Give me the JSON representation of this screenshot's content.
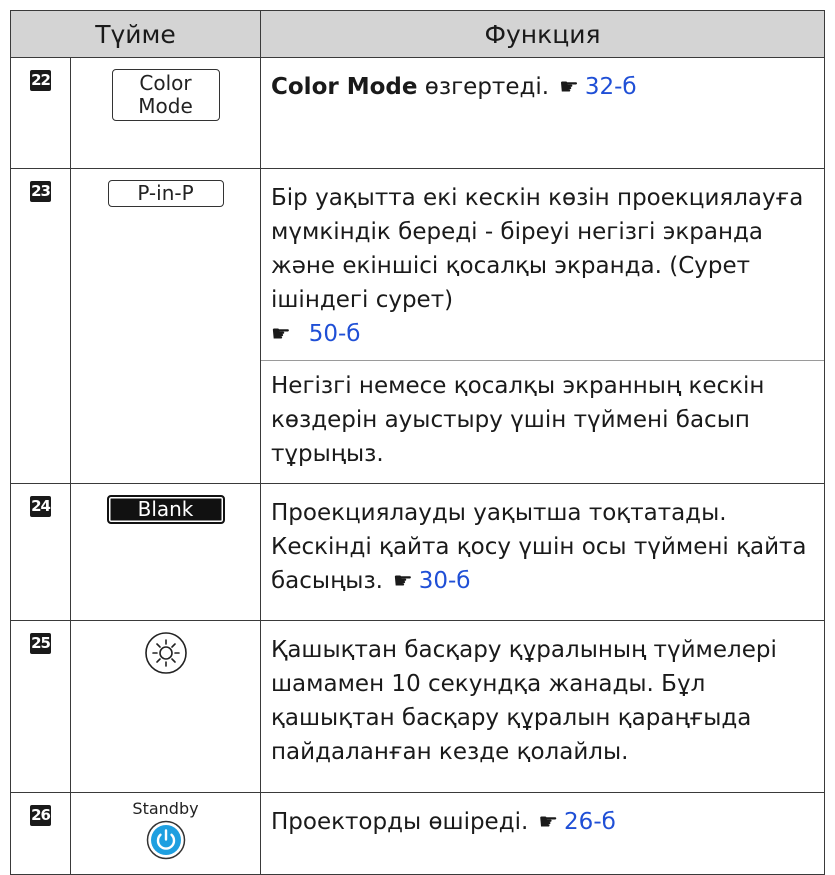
{
  "header": {
    "col_button": "Түйме",
    "col_function": "Функция"
  },
  "rows": [
    {
      "num": "22",
      "button_lines": [
        "Color",
        "Mode"
      ],
      "bold": "Color Mode",
      "text": " өзгертеді.",
      "ref": "32-б"
    },
    {
      "num": "23",
      "button_label": "P-in-P",
      "para1": "Бір уақытта екі кескін көзін проекциялауға мүмкіндік береді - біреуі негізгі экранда және екіншісі қосалқы экранда. (Сурет ішіндегі сурет)",
      "ref": "50-б",
      "para2": "Негізгі немесе қосалқы экранның кескін көздерін ауыстыру үшін түймені басып тұрыңыз."
    },
    {
      "num": "24",
      "button_label": "Blank",
      "text": "Проекциялауды уақытша тоқтатады. Кескінді қайта қосу үшін осы түймені қайта басыңыз.",
      "ref": "30-б"
    },
    {
      "num": "25",
      "button_icon": "backlight-sun-icon",
      "text": "Қашықтан басқару құралының түймелері шамамен 10 секундқа жанады. Бұл қашықтан басқару құралын қараңғыда пайдаланған кезде қолайлы."
    },
    {
      "num": "26",
      "button_label": "Standby",
      "button_icon": "power-icon",
      "text": "Проекторды өшіреді.",
      "ref": "26-б"
    }
  ],
  "colors": {
    "link": "#1f4fd6",
    "header_bg": "#d4d4d4",
    "power_fill": "#1e9fe0"
  }
}
